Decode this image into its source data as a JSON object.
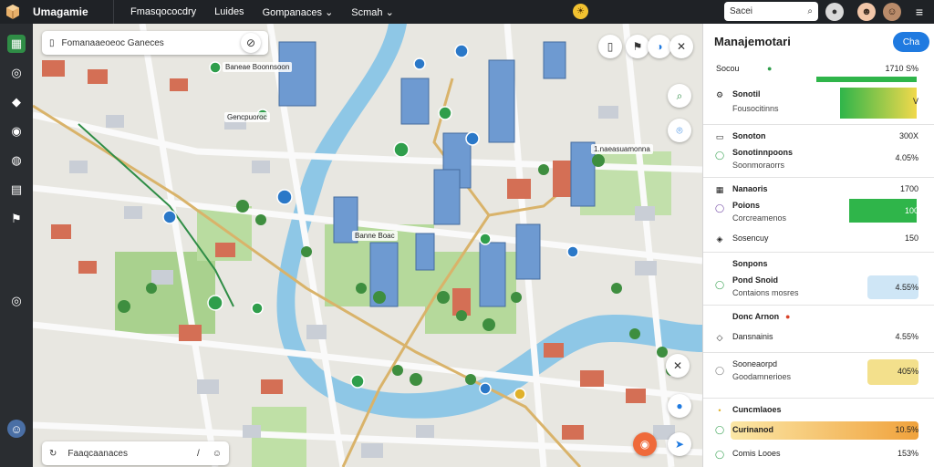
{
  "topbar": {
    "logo_icon": "package-icon",
    "app_name": "Umagamie",
    "nav": [
      {
        "label": "Fmasqococdry",
        "has_chevron": false
      },
      {
        "label": "Luides",
        "has_chevron": false
      },
      {
        "label": "Gompanaces",
        "has_chevron": true
      },
      {
        "label": "Scmah",
        "has_chevron": true
      }
    ],
    "search_placeholder": "Sacei"
  },
  "map": {
    "search_value": "Fomanaaeoeoc Ganeces",
    "bottom_search_value": "Faaqcaanaces"
  },
  "panel": {
    "title": "Manajemotari",
    "button_label": "Cha",
    "rows": [
      {
        "name": "Socou",
        "value": "1710 S%"
      },
      {
        "name": "Sonotil",
        "sub": "Fousocitinns",
        "value": "V"
      },
      {
        "name": "Sonoton",
        "value": "300X"
      },
      {
        "name": "Sonotinnpoons",
        "sub": "Soonmoraorrs",
        "value": "4.05%"
      },
      {
        "name": "Nanaoris",
        "value": "1700"
      },
      {
        "name": "Poions",
        "sub": "Corcreamenos",
        "value": "100"
      },
      {
        "name": "Sosencuy",
        "value": "150"
      },
      {
        "name": "Sonpons",
        "value": ""
      },
      {
        "name": "Pond Snoid",
        "sub": "Contaions mosres",
        "value": "4.55%"
      },
      {
        "name": "Donc Arnon",
        "value": ""
      },
      {
        "name": "Dansnainis",
        "value": "4.55%"
      },
      {
        "name": "Sooneaorpd",
        "sub": "Goodamnerioes",
        "value": "405%"
      },
      {
        "name": "Cuncmlaoes",
        "value": ""
      },
      {
        "name": "Curinanod",
        "value": "10.5%"
      },
      {
        "name": "Comis Looes",
        "value": "153%"
      }
    ]
  },
  "map_labels": [
    "Baneae Boonnsoon",
    "Gencpuoroc",
    "1.naeasuamonna",
    "Banne Boac"
  ]
}
